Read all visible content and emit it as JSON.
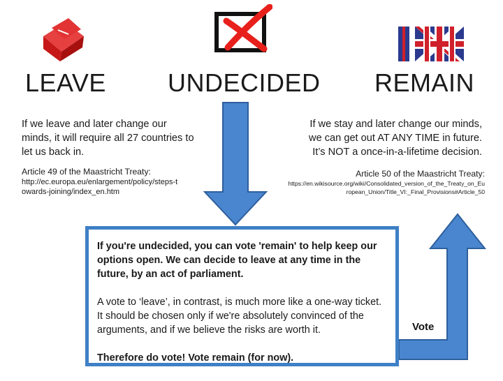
{
  "colors": {
    "arrow_fill": "#4a86cf",
    "arrow_stroke": "#2e5f9c",
    "box_border": "#3f80c6",
    "leave_box_red": "#d32020",
    "cross_red": "#e8201c",
    "union_blue": "#2b3a8f",
    "union_red": "#d0202b"
  },
  "icons": {
    "leave": "red-ballot-box-icon",
    "undecided": "crossed-ballot-icon",
    "remain": "union-jack-in-icon"
  },
  "headings": {
    "leave": "LEAVE",
    "undecided": "UNDECIDED",
    "remain": "REMAIN"
  },
  "leave_side": {
    "paragraph": "If we leave and later change our minds, it will require all 27 countries to let us back in.",
    "article_title": "Article 49 of the Maastricht Treaty:",
    "article_url": "http://ec.europa.eu/enlargement/policy/steps-towards-joining/index_en.htm"
  },
  "remain_side": {
    "paragraph_line1": "If we stay and later change our minds,",
    "paragraph_line2": "we can get out AT ANY TIME in future.",
    "paragraph_line3": "It’s NOT a once-in-a-lifetime decision.",
    "article_title": "Article 50 of the Maastricht Treaty:",
    "article_url": "https://en.wikisource.org/wiki/Consolidated_version_of_the_Treaty_on_European_Union/Title_VI:_Final_Provisions#Article_50"
  },
  "message": {
    "bold_paragraph": "If you're undecided, you can vote 'remain' to help keep our options open. We can decide to leave at any time in the future, by an act of parliament.",
    "normal_paragraph": "A vote to ‘leave’, in contrast, is much more like a one-way ticket. It should be chosen only if we're absolutely convinced of the arguments, and if we believe the risks are worth it.",
    "closing_paragraph": "Therefore do vote! Vote remain (for now)."
  },
  "vote_label": "Vote"
}
